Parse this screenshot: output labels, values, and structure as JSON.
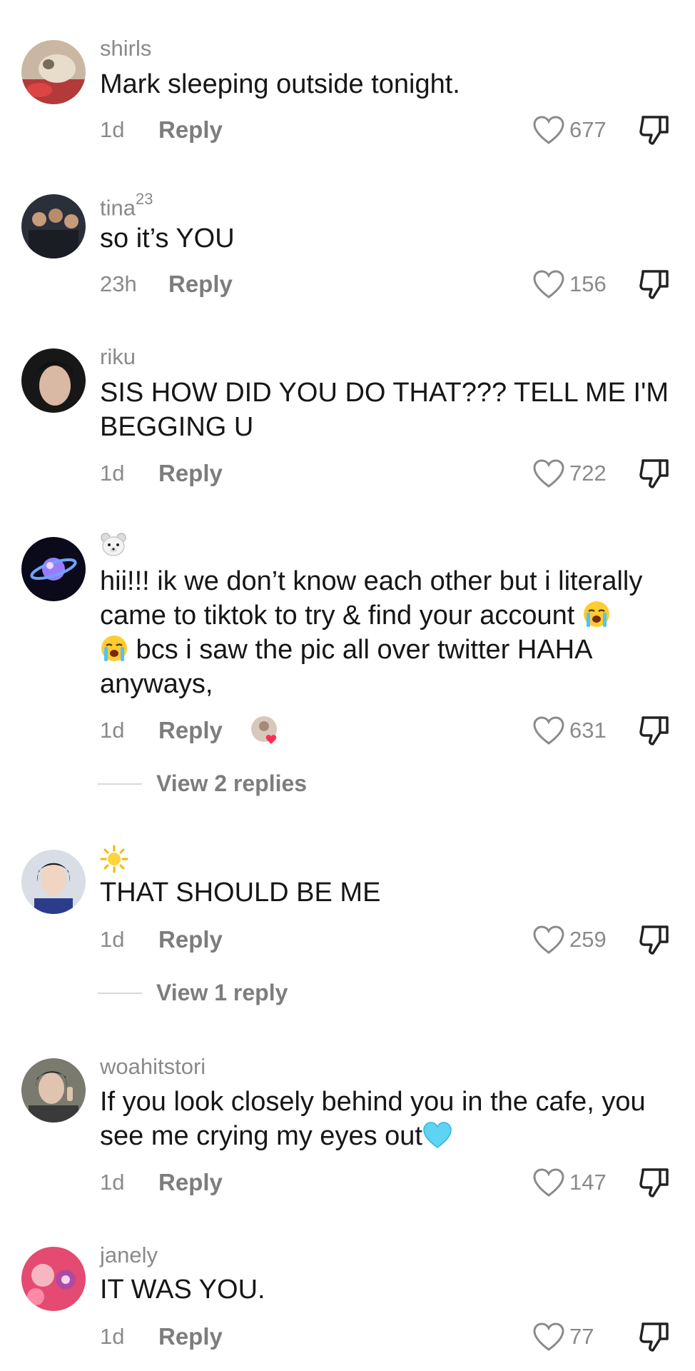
{
  "labels": {
    "reply": "Reply"
  },
  "comments": [
    {
      "username": "shirls",
      "text": "Mark sleeping outside tonight.",
      "time": "1d",
      "likes": "677"
    },
    {
      "username": "tina",
      "username_sup": "23",
      "text": "so it’s YOU",
      "time": "23h",
      "likes": "156"
    },
    {
      "username": "riku",
      "text_line1": "SIS HOW DID YOU DO THAT??? TELL ME I'M",
      "text_line2": "BEGGING U",
      "time": "1d",
      "likes": "722"
    },
    {
      "username_icon": "polar-bear-emoji",
      "text_line1": "hii!!! ik we don’t know each other but i literally",
      "text_line2": "came to tiktok to try & find your account",
      "text_line3": " bcs i saw the pic all over twitter HAHA",
      "text_line4": "anyways,",
      "inline_emoji": "loudly-crying-face-emoji",
      "time": "1d",
      "likes": "631",
      "view_replies": "View 2 replies"
    },
    {
      "username_icon": "sun-emoji",
      "text": "THAT SHOULD BE ME",
      "time": "1d",
      "likes": "259",
      "view_replies": "View 1 reply"
    },
    {
      "username": "woahitstori",
      "text_line1": "If you look closely behind you in the cafe, you",
      "text_line2": "see me crying my eyes out",
      "inline_emoji": "light-blue-heart-emoji",
      "time": "1d",
      "likes": "147"
    },
    {
      "username": "janely",
      "text": "IT WAS YOU.",
      "time": "1d",
      "likes": "77"
    }
  ],
  "colors": {
    "text": "#161616",
    "muted": "#8a8a8a",
    "heart_outline": "#8a8a8a"
  }
}
